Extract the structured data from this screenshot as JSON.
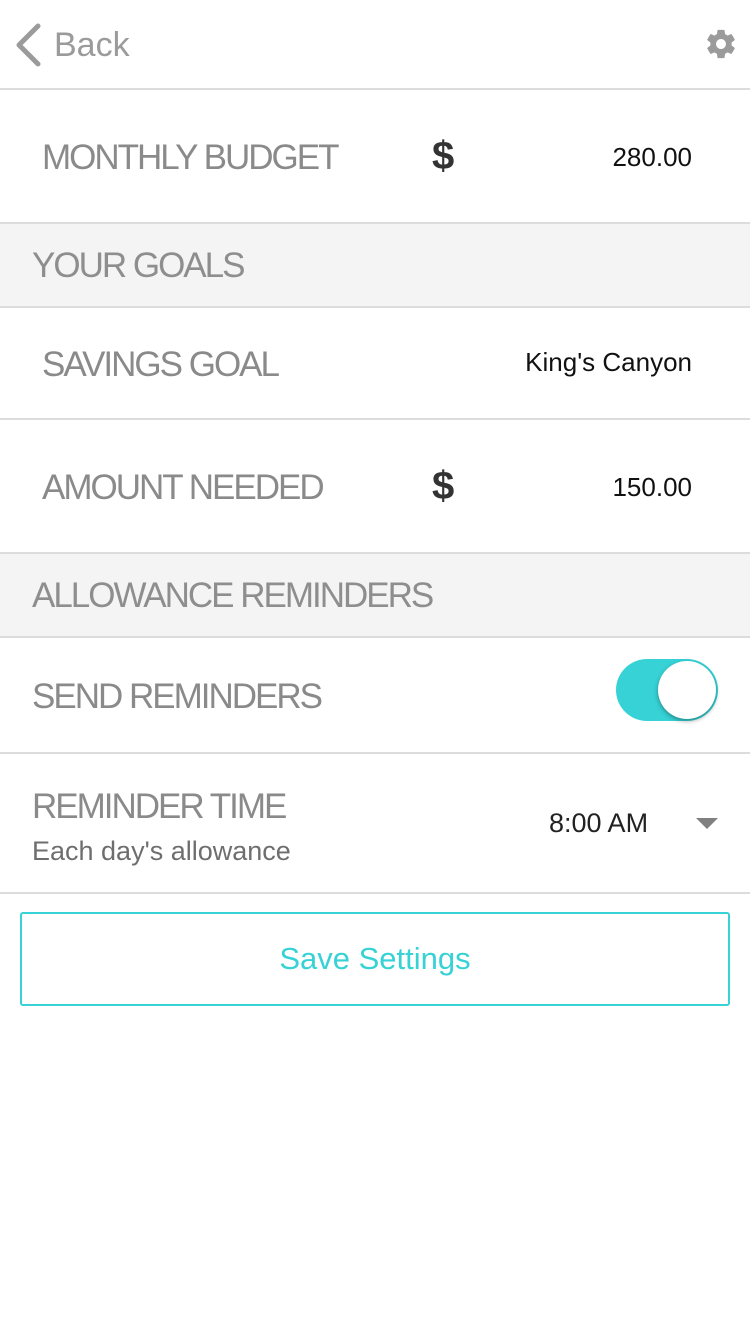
{
  "nav": {
    "back_label": "Back",
    "back_icon": "chevron-left-icon",
    "settings_icon": "gear-icon"
  },
  "budget": {
    "label": "MONTHLY BUDGET",
    "currency": "$",
    "value": "280.00"
  },
  "goals_section": {
    "title": "YOUR GOALS"
  },
  "savings_goal": {
    "label": "SAVINGS GOAL",
    "value": "King's Canyon"
  },
  "amount_needed": {
    "label": "AMOUNT NEEDED",
    "currency": "$",
    "value": "150.00"
  },
  "reminders_section": {
    "title": "ALLOWANCE REMINDERS"
  },
  "send_reminders": {
    "label": "SEND REMINDERS",
    "enabled": true
  },
  "reminder_time": {
    "label": "REMINDER TIME",
    "sublabel": "Each day's allowance",
    "value": "8:00 AM",
    "dropdown_icon": "caret-down-icon"
  },
  "save_button": {
    "label": "Save Settings"
  },
  "colors": {
    "accent": "#36d2d6",
    "section_bg": "#f4f4f4",
    "divider": "#dcdcdc",
    "label_gray": "#8a8a8a"
  }
}
